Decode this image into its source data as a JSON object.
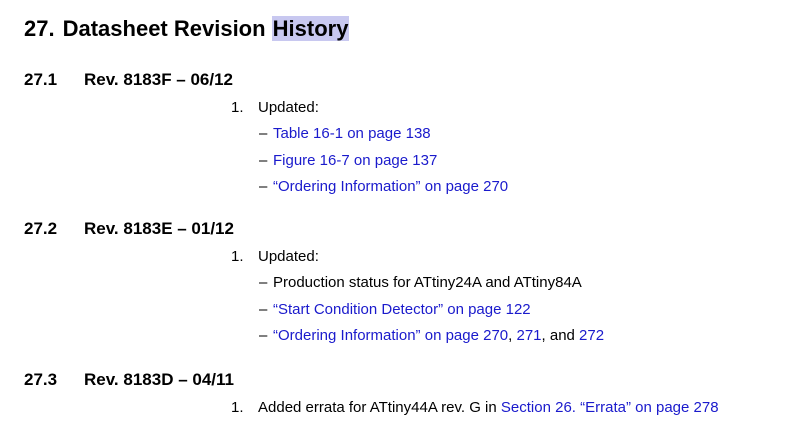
{
  "chapter": {
    "number": "27.",
    "title_main": "Datasheet Revision ",
    "title_highlight": "History"
  },
  "sections": [
    {
      "number": "27.1",
      "title": "Rev. 8183F – 06/12",
      "item_number": "1.",
      "item_text": "Updated:",
      "subitems": [
        {
          "dash": "–",
          "parts": [
            {
              "text": "Table 16-1 on page 138",
              "link": true
            }
          ]
        },
        {
          "dash": "–",
          "parts": [
            {
              "text": "Figure 16-7 on page 137",
              "link": true
            }
          ]
        },
        {
          "dash": "–",
          "parts": [
            {
              "text": "“Ordering Information” on page 270",
              "link": true
            }
          ]
        }
      ]
    },
    {
      "number": "27.2",
      "title": "Rev. 8183E – 01/12",
      "item_number": "1.",
      "item_text": "Updated:",
      "subitems": [
        {
          "dash": "–",
          "parts": [
            {
              "text": "Production status for ATtiny24A and ATtiny84A",
              "link": false
            }
          ]
        },
        {
          "dash": "–",
          "parts": [
            {
              "text": "“Start Condition Detector” on page 122",
              "link": true
            }
          ]
        },
        {
          "dash": "–",
          "parts": [
            {
              "text": "“Ordering Information” on page 270",
              "link": true
            },
            {
              "text": ", ",
              "link": false
            },
            {
              "text": "271",
              "link": true
            },
            {
              "text": ", and ",
              "link": false
            },
            {
              "text": "272",
              "link": true
            }
          ]
        }
      ]
    },
    {
      "number": "27.3",
      "title": "Rev. 8183D – 04/11",
      "item_number": "1.",
      "item_parts": [
        {
          "text": "Added errata for ATtiny44A rev. G in ",
          "link": false
        },
        {
          "text": "Section 26. “Errata” on page 278",
          "link": true
        }
      ]
    }
  ]
}
